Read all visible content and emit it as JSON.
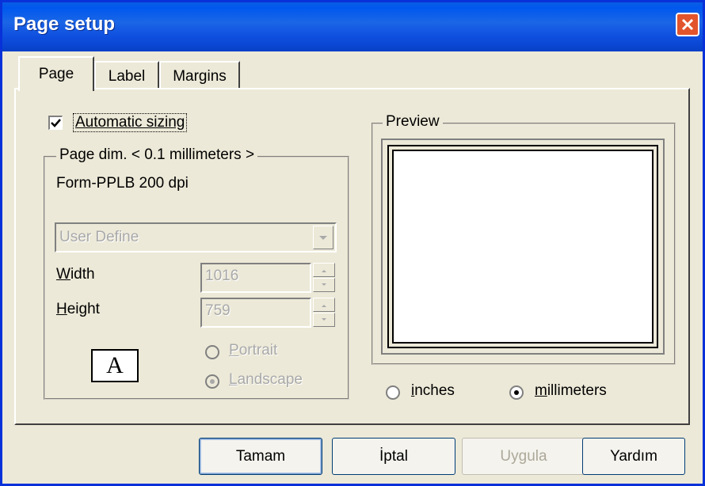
{
  "window": {
    "title": "Page setup"
  },
  "tabs": [
    {
      "label": "Page",
      "active": true
    },
    {
      "label": "Label",
      "active": false
    },
    {
      "label": "Margins",
      "active": false
    }
  ],
  "page_tab": {
    "auto_sizing_label": "Automatic sizing",
    "auto_sizing_checked": true,
    "page_dim_group": "Page dim. < 0.1 millimeters >",
    "printer_name": "Form-PPLB 200 dpi",
    "size_select": "User Define",
    "width_label": "Width",
    "width_value": "1016",
    "height_label": "Height",
    "height_value": "759",
    "orientation_icon_letter": "A",
    "portrait_label": "Portrait",
    "landscape_label": "Landscape",
    "orientation_selected": "Landscape",
    "preview_group": "Preview",
    "unit_inches_label": "inches",
    "unit_mm_label": "millimeters",
    "unit_selected": "millimeters"
  },
  "buttons": {
    "ok": "Tamam",
    "cancel": "İptal",
    "apply": "Uygula",
    "help": "Yardım"
  },
  "colors": {
    "titlebar": "#0058ee",
    "close": "#e2542c",
    "face": "#ece9d8"
  },
  "icons": {
    "close": "close-icon",
    "check": "checkmark-icon",
    "dropdown": "chevron-down-icon",
    "spin_up": "spin-up-icon",
    "spin_down": "spin-down-icon"
  }
}
